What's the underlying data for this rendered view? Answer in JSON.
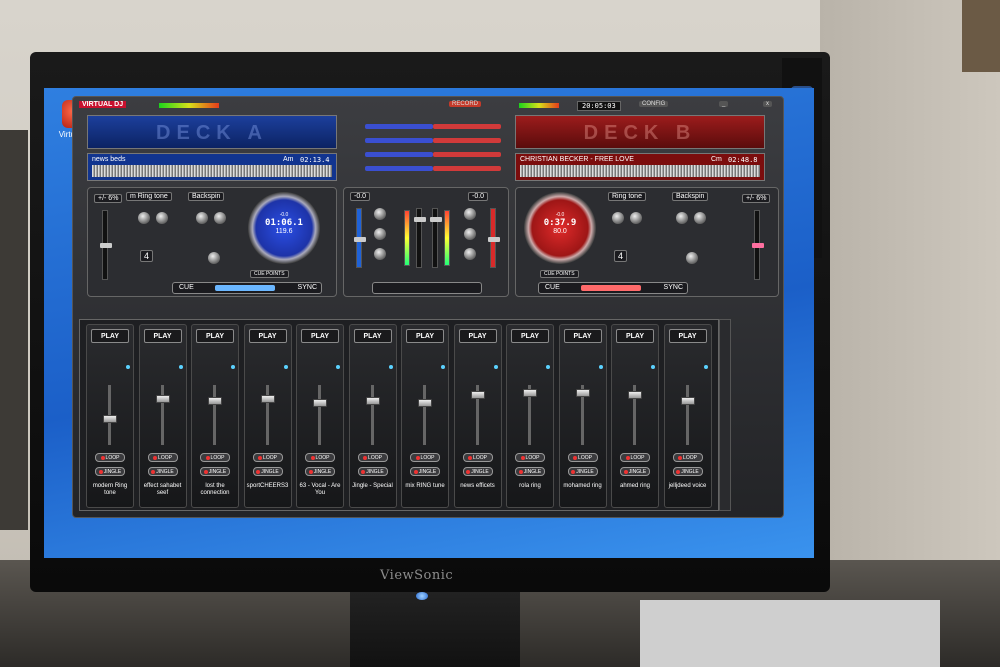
{
  "desktop": {
    "icon_label": "Virtual DJ"
  },
  "monitor": {
    "brand": "ViewSonic"
  },
  "app": {
    "logo": "VIRTUAL DJ",
    "clock": "20:05:03",
    "config_label": "CONFIG",
    "record_label": "RECORD"
  },
  "deck_a": {
    "wave_label": "DECK A",
    "title": "news beds",
    "key": "Am",
    "time": "02:13.4",
    "pitch": "+/- 6%",
    "jog_top": "-0.0",
    "jog_time": "01:06.1",
    "jog_bpm": "119.6",
    "jog_remain": "REMAIN",
    "sampler_effect": "m Ring tone",
    "effect": "Backspin",
    "loop_value": "4",
    "cue": "CUE",
    "sync": "SYNC",
    "cue_points": "CUE POINTS"
  },
  "deck_b": {
    "wave_label": "DECK B",
    "title": "CHRISTIAN BECKER - FREE LOVE",
    "key": "Cm",
    "time": "02:48.8",
    "pitch": "+/- 6%",
    "jog_top": "-0.0",
    "jog_time": "0:37.9",
    "jog_bpm": "80.0",
    "jog_remain": "REMAIN",
    "sampler_effect": "Ring tone",
    "effect": "Backspin",
    "loop_value": "4",
    "cue": "CUE",
    "sync": "SYNC",
    "cue_points": "CUE POINTS"
  },
  "mixer": {
    "gain_a": "-0.0",
    "gain_b": "-0.0"
  },
  "sampler": {
    "play_label": "PLAY",
    "loop_label": "LOOP",
    "jingle_label": "JINGLE",
    "slots": [
      {
        "name": "modern Ring tone"
      },
      {
        "name": "effect sahabet seef"
      },
      {
        "name": "lost the connection"
      },
      {
        "name": "sportCHEERS3"
      },
      {
        "name": "63 - Vocal - Are You"
      },
      {
        "name": "Jingle - Special"
      },
      {
        "name": "mix RING tune"
      },
      {
        "name": "news efficets"
      },
      {
        "name": "rola ring"
      },
      {
        "name": "mohamed ring"
      },
      {
        "name": "ahmed ring"
      },
      {
        "name": "jelljdeed voice"
      }
    ]
  },
  "colors": {
    "deck_a": "#1d33a8",
    "deck_b": "#9e1616",
    "desktop": "#1b5fc8"
  }
}
